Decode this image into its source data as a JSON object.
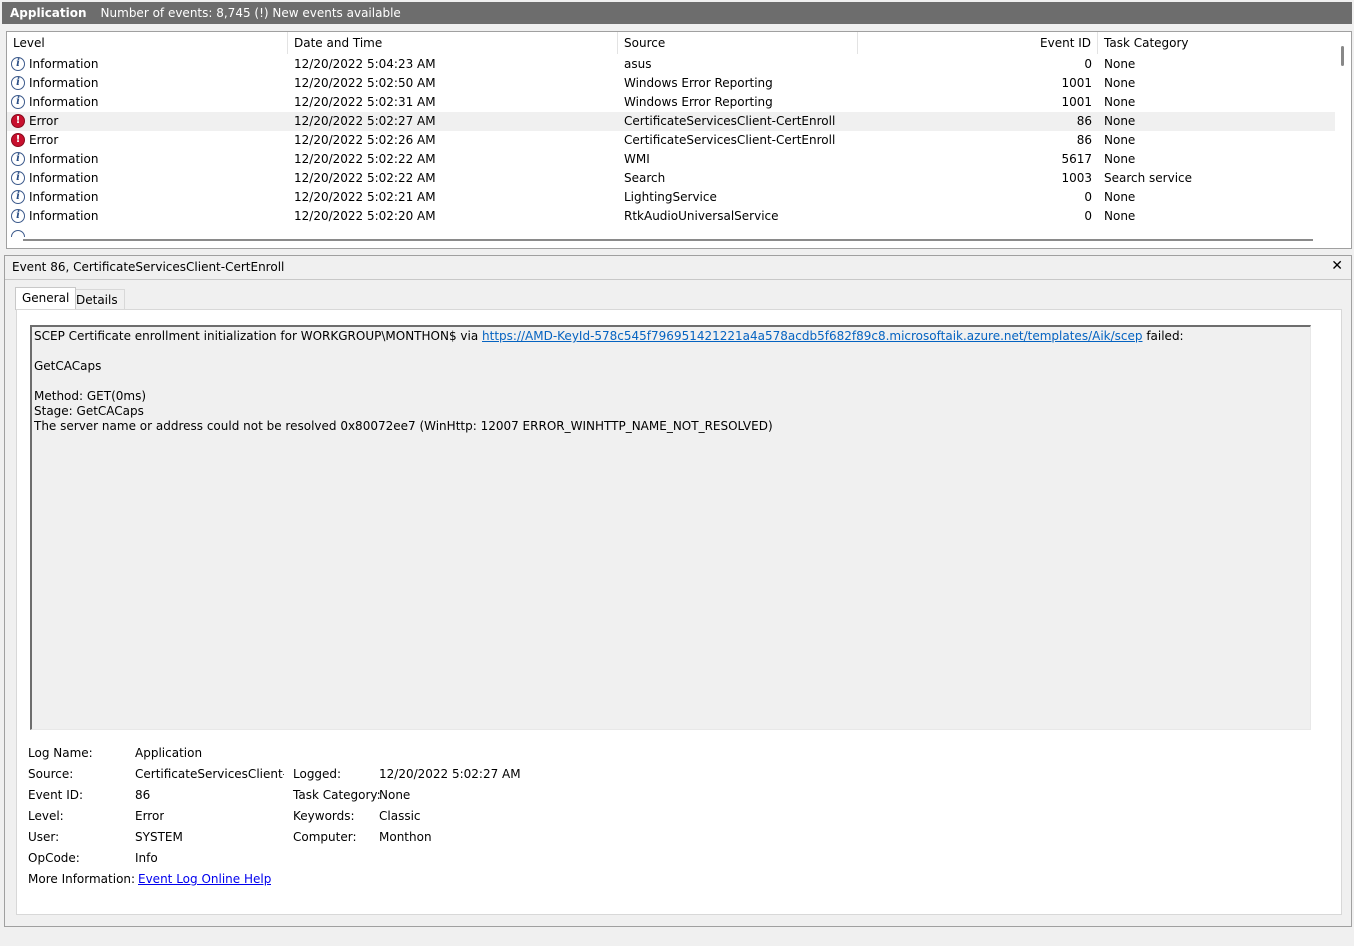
{
  "titlebar": {
    "log_name": "Application",
    "event_count": "Number of events: 8,745 (!) New events available"
  },
  "table": {
    "columns": [
      "Level",
      "Date and Time",
      "Source",
      "Event ID",
      "Task Category"
    ],
    "rows": [
      {
        "level": "Information",
        "icon": "info-icon",
        "datetime": "12/20/2022 5:04:23 AM",
        "source": "asus",
        "event_id": "0",
        "task": "None"
      },
      {
        "level": "Information",
        "icon": "info-icon",
        "datetime": "12/20/2022 5:02:50 AM",
        "source": "Windows Error Reporting",
        "event_id": "1001",
        "task": "None"
      },
      {
        "level": "Information",
        "icon": "info-icon",
        "datetime": "12/20/2022 5:02:31 AM",
        "source": "Windows Error Reporting",
        "event_id": "1001",
        "task": "None"
      },
      {
        "level": "Error",
        "icon": "error-icon",
        "datetime": "12/20/2022 5:02:27 AM",
        "source": "CertificateServicesClient-CertEnroll",
        "event_id": "86",
        "task": "None",
        "selected": true
      },
      {
        "level": "Error",
        "icon": "error-icon",
        "datetime": "12/20/2022 5:02:26 AM",
        "source": "CertificateServicesClient-CertEnroll",
        "event_id": "86",
        "task": "None"
      },
      {
        "level": "Information",
        "icon": "info-icon",
        "datetime": "12/20/2022 5:02:22 AM",
        "source": "WMI",
        "event_id": "5617",
        "task": "None"
      },
      {
        "level": "Information",
        "icon": "info-icon",
        "datetime": "12/20/2022 5:02:22 AM",
        "source": "Search",
        "event_id": "1003",
        "task": "Search service"
      },
      {
        "level": "Information",
        "icon": "info-icon",
        "datetime": "12/20/2022 5:02:21 AM",
        "source": "LightingService",
        "event_id": "0",
        "task": "None"
      },
      {
        "level": "Information",
        "icon": "info-icon",
        "datetime": "12/20/2022 5:02:20 AM",
        "source": "RtkAudioUniversalService",
        "event_id": "0",
        "task": "None"
      }
    ]
  },
  "detail": {
    "title": "Event 86, CertificateServicesClient-CertEnroll",
    "close_glyph": "✕",
    "tabs": {
      "general": "General",
      "details": "Details"
    },
    "message": {
      "line1_prefix": "SCEP Certificate enrollment initialization for WORKGROUP\\MONTHON$ via ",
      "line1_link": "https://AMD-KeyId-578c545f796951421221a4a578acdb5f682f89c8.microsoftaik.azure.net/templates/Aik/scep",
      "line1_suffix": " failed:",
      "line2": "GetCACaps",
      "line3": "Method: GET(0ms)",
      "line4": "Stage: GetCACaps",
      "line5": "The server name or address could not be resolved 0x80072ee7 (WinHttp: 12007 ERROR_WINHTTP_NAME_NOT_RESOLVED)"
    },
    "props": {
      "log_name_label": "Log Name:",
      "log_name": "Application",
      "source_label": "Source:",
      "source": "CertificateServicesClient-CertEnroll",
      "logged_label": "Logged:",
      "logged": "12/20/2022 5:02:27 AM",
      "event_id_label": "Event ID:",
      "event_id": "86",
      "task_label": "Task Category:",
      "task": "None",
      "level_label": "Level:",
      "level": "Error",
      "keywords_label": "Keywords:",
      "keywords": "Classic",
      "user_label": "User:",
      "user": "SYSTEM",
      "computer_label": "Computer:",
      "computer": "Monthon",
      "opcode_label": "OpCode:",
      "opcode": "Info",
      "more_info_label": "More Information:",
      "more_info_link": "Event Log Online Help"
    }
  }
}
